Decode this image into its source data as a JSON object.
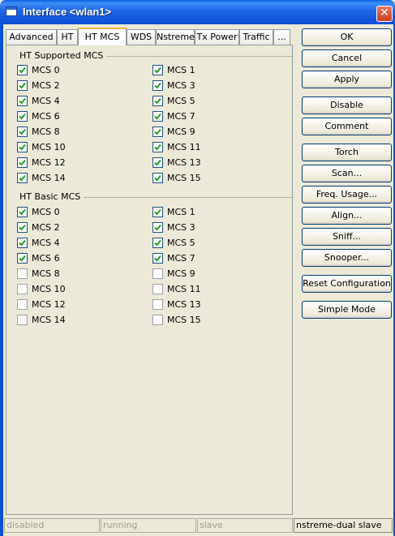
{
  "window": {
    "title": "Interface <wlan1>",
    "close_symbol": "✕"
  },
  "tabs": [
    {
      "label": "Advanced"
    },
    {
      "label": "HT"
    },
    {
      "label": "HT MCS",
      "active": true
    },
    {
      "label": "WDS"
    },
    {
      "label": "Nstreme"
    },
    {
      "label": "Tx Power"
    },
    {
      "label": "Traffic"
    },
    {
      "label": "..."
    }
  ],
  "ht_supported": {
    "title": "HT Supported MCS",
    "items": [
      {
        "label": "MCS 0",
        "checked": true
      },
      {
        "label": "MCS 1",
        "checked": true
      },
      {
        "label": "MCS 2",
        "checked": true
      },
      {
        "label": "MCS 3",
        "checked": true
      },
      {
        "label": "MCS 4",
        "checked": true
      },
      {
        "label": "MCS 5",
        "checked": true
      },
      {
        "label": "MCS 6",
        "checked": true
      },
      {
        "label": "MCS 7",
        "checked": true
      },
      {
        "label": "MCS 8",
        "checked": true
      },
      {
        "label": "MCS 9",
        "checked": true
      },
      {
        "label": "MCS 10",
        "checked": true
      },
      {
        "label": "MCS 11",
        "checked": true
      },
      {
        "label": "MCS 12",
        "checked": true
      },
      {
        "label": "MCS 13",
        "checked": true
      },
      {
        "label": "MCS 14",
        "checked": true
      },
      {
        "label": "MCS 15",
        "checked": true
      }
    ]
  },
  "ht_basic": {
    "title": "HT Basic MCS",
    "items": [
      {
        "label": "MCS 0",
        "checked": true
      },
      {
        "label": "MCS 1",
        "checked": true
      },
      {
        "label": "MCS 2",
        "checked": true
      },
      {
        "label": "MCS 3",
        "checked": true
      },
      {
        "label": "MCS 4",
        "checked": true
      },
      {
        "label": "MCS 5",
        "checked": true
      },
      {
        "label": "MCS 6",
        "checked": true
      },
      {
        "label": "MCS 7",
        "checked": true
      },
      {
        "label": "MCS 8",
        "checked": false
      },
      {
        "label": "MCS 9",
        "checked": false
      },
      {
        "label": "MCS 10",
        "checked": false
      },
      {
        "label": "MCS 11",
        "checked": false
      },
      {
        "label": "MCS 12",
        "checked": false
      },
      {
        "label": "MCS 13",
        "checked": false
      },
      {
        "label": "MCS 14",
        "checked": false
      },
      {
        "label": "MCS 15",
        "checked": false
      }
    ]
  },
  "buttons": {
    "ok": "OK",
    "cancel": "Cancel",
    "apply": "Apply",
    "disable": "Disable",
    "comment": "Comment",
    "torch": "Torch",
    "scan": "Scan...",
    "freq_usage": "Freq. Usage...",
    "align": "Align...",
    "sniff": "Sniff...",
    "snooper": "Snooper...",
    "reset_configuration": "Reset Configuration",
    "simple_mode": "Simple Mode"
  },
  "status": [
    "disabled",
    "running",
    "slave",
    "nstreme-dual slave"
  ],
  "colors": {
    "titlebar": "#0b4fd4",
    "window_bg": "#ece9d8",
    "active_tab_accent": "#f5b63e",
    "close_button": "#c8401f"
  }
}
